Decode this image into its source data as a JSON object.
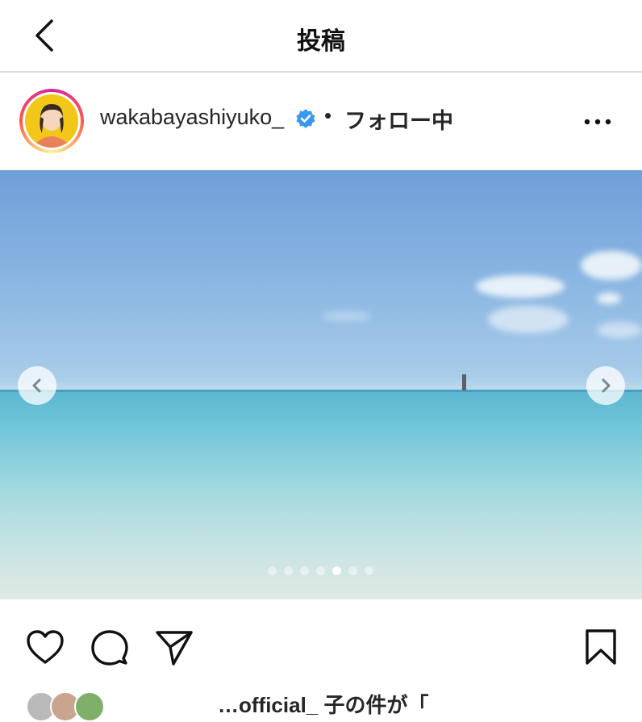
{
  "header": {
    "title": "投稿"
  },
  "post": {
    "username": "wakabayashiyuko_",
    "separator": "•",
    "follow_status": "フォロー中"
  },
  "carousel": {
    "slide_count": 7,
    "active_index": 4
  },
  "caption_preview": "…official_ 子の件が「",
  "colors": {
    "accent_verified": "#3897f0",
    "divider": "#dbdbdb",
    "text": "#262626"
  },
  "icons": {
    "back": "back-chevron-icon",
    "verified": "verified-badge-icon",
    "more": "more-options-icon",
    "like": "heart-icon",
    "comment": "comment-icon",
    "share": "paper-plane-icon",
    "save": "bookmark-icon",
    "prev": "chevron-left-icon",
    "next": "chevron-right-icon"
  }
}
